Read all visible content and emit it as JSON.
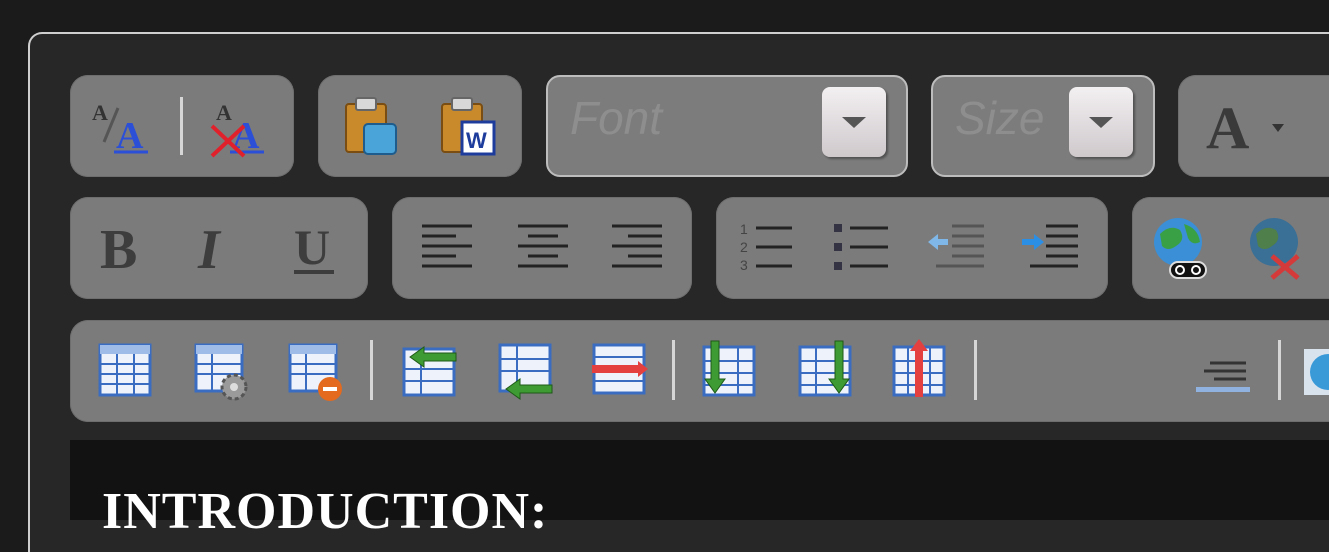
{
  "toolbar": {
    "font_placeholder": "Font",
    "size_placeholder": "Size",
    "icons_row1": [
      "style-icon",
      "remove-format-icon",
      "paste-text-icon",
      "paste-word-icon",
      "text-color-icon"
    ],
    "icons_row2": [
      "bold-icon",
      "italic-icon",
      "underline-icon",
      "align-left-icon",
      "align-center-icon",
      "align-right-icon",
      "ordered-list-icon",
      "unordered-list-icon",
      "outdent-icon",
      "indent-icon",
      "link-icon",
      "unlink-icon"
    ],
    "icons_row3": [
      "table-icon",
      "table-properties-icon",
      "delete-table-icon",
      "insert-row-before-icon",
      "insert-row-after-icon",
      "delete-row-icon",
      "insert-column-before-icon",
      "insert-column-after-icon",
      "delete-column-icon",
      "horizontal-rule-icon"
    ]
  },
  "editor": {
    "heading": "INTRODUCTION:"
  },
  "colors": {
    "group_bg": "#7b7b7b",
    "page_bg": "#1b1b1b",
    "editor_bg": "#121212",
    "link_blue": "#2b4fd6",
    "remove_red": "#e0212b"
  }
}
